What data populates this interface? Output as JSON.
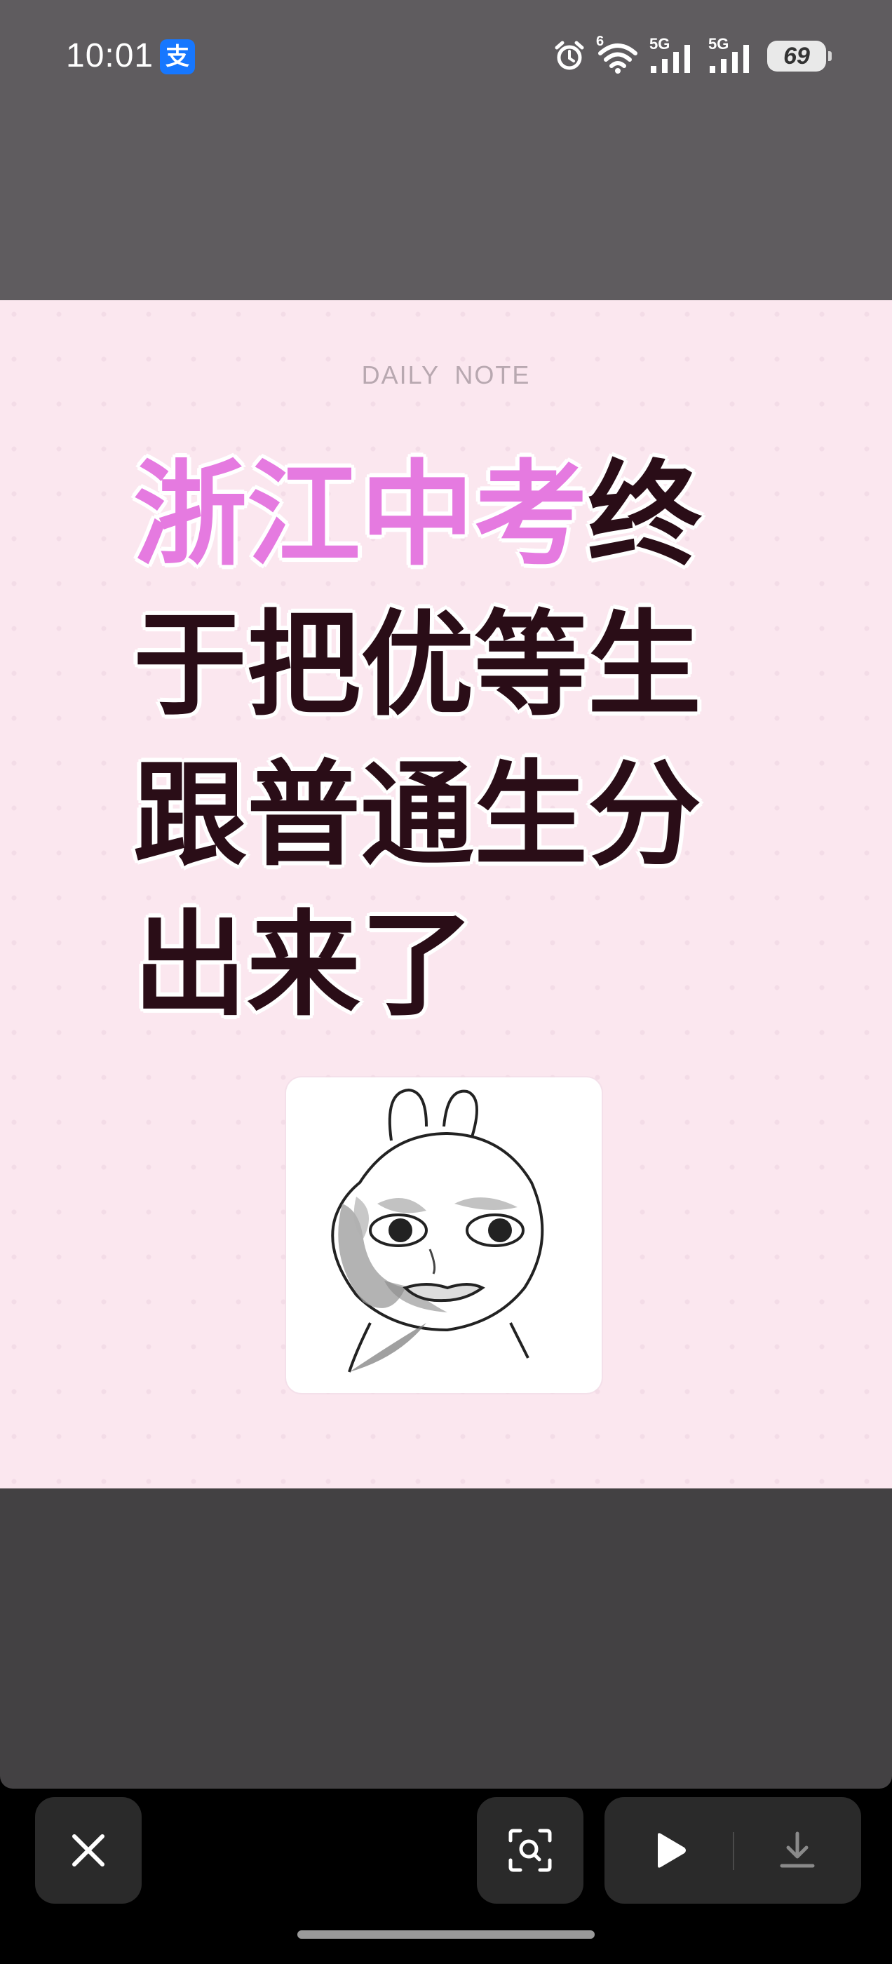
{
  "status_bar": {
    "time": "10:01",
    "app_badge": "支",
    "network_1": "5G",
    "network_2": "5G",
    "wifi_label": "6",
    "battery": "69",
    "icons": [
      "alarm-icon",
      "wifi-icon",
      "signal-icon",
      "signal-icon",
      "battery-icon"
    ]
  },
  "image": {
    "header": "DAILY NOTE",
    "headline": {
      "line1_highlight": "浙江中考",
      "line1_rest": "终",
      "line2": "于把优等生",
      "line3": "跟普通生分",
      "line4": "出来了"
    },
    "highlight_color": "#e57ae0",
    "text_color": "#2a0d17",
    "background_color": "#fbe7ef",
    "meme": "rabbit-face-meme"
  },
  "toolbar": {
    "buttons": [
      "close-icon",
      "visual-search-icon",
      "play-icon",
      "download-icon"
    ]
  }
}
